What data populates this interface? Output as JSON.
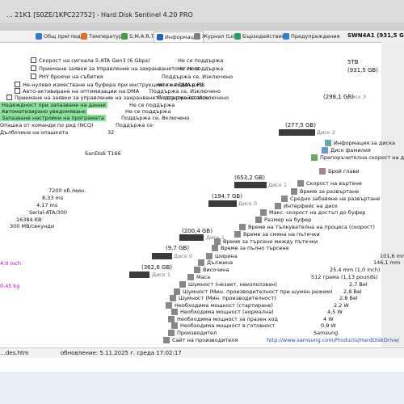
{
  "window": {
    "title": "... 21K1 [S0ZE/1KPC22752] - Hard Disk Sentinel 4.20 PRO",
    "right_model": "SWN4A1 (931,5 GB)"
  },
  "tabs": [
    {
      "label": "Общ преглед",
      "color": "#2d7bd8"
    },
    {
      "label": "Температура",
      "color": "#e07020"
    },
    {
      "label": "S.M.A.R.T.",
      "color": "#40a040"
    },
    {
      "label": "Информация",
      "color": "#2060c0"
    },
    {
      "label": "Журнал (Log)",
      "color": "#808080"
    },
    {
      "label": "Бързодействие",
      "color": "#20a060"
    },
    {
      "label": "Предупреждения",
      "color": "#3080d0"
    }
  ],
  "left_rows": [
    {
      "label": "Скорост на сигнала 5-ATA Gen3 (6 Gbps)",
      "value": "Не се поддържа"
    },
    {
      "label": "Приемане заявки за Управление на захранването от Host",
      "value": "Не се поддържа"
    },
    {
      "label": "PHY броячи на събития",
      "value": "Поддържа се, Изключено"
    },
    {
      "label": "Не-нулево изместване на буфера при инструкциите на DMA в PIS",
      "value": "Не се поддържа"
    },
    {
      "label": "Авто-активиране на оптимизации на DMA",
      "value": "Поддържа се, Изключено"
    },
    {
      "label": "Приемане на заявки за управление на захранването от устройството",
      "value": "Поддържа се, Изключено"
    },
    {
      "label": "Надеждност при запазване на данни",
      "value": "Не се поддържа"
    },
    {
      "label": "Автоматизирано уведомяване",
      "value": "Не се поддържа"
    },
    {
      "label": "Запазване настройки на програмата",
      "value": "Поддържа се, Включено"
    },
    {
      "label": "Опашка от команди по ред (NCQ)",
      "value": "Поддържа се"
    },
    {
      "label": "Дълбочина на опашката",
      "value": "32"
    }
  ],
  "left_info": [
    {
      "label": "Модел",
      "value": "SanDisk T166"
    },
    {
      "label": "Скорост",
      "value": "7200 об./мин."
    },
    {
      "label": "Време",
      "value": "8,33 ms"
    },
    {
      "label": "Латентност",
      "value": "4,17 ms"
    },
    {
      "label": "Интерфейс",
      "value": "Serial-ATA/300"
    },
    {
      "label": "Буфер",
      "value": "16384 KB"
    },
    {
      "label": "Скорост на диска",
      "value": "300 MB/секунди"
    },
    {
      "label": "Размер",
      "value": "4,0 inch"
    },
    {
      "label": "Тегло",
      "value": "0,45 kg"
    }
  ],
  "right_rows": [
    {
      "label": "Информация за диска"
    },
    {
      "label": "Диск фамилия"
    },
    {
      "label": "Препоръчителна скорост на диска"
    },
    {
      "label": "Брой глави"
    },
    {
      "label": "Скорост на въртене"
    },
    {
      "label": "Време за развъртане"
    },
    {
      "label": "Средно забавяне на развъртане"
    },
    {
      "label": "Интерфейс на диск"
    },
    {
      "label": "Макс. скорост на достъп до буфер"
    },
    {
      "label": "Размер на буфер"
    },
    {
      "label": "Време на тълкувателна на процеса (скорост)"
    },
    {
      "label": "Време за смяна на пътечки"
    },
    {
      "label": "Време за търсене между пътечки"
    },
    {
      "label": "Време за пълно търсене"
    },
    {
      "label": "Ширина",
      "value": "101,6 mm"
    },
    {
      "label": "Дължина",
      "value": "146,1 mm"
    },
    {
      "label": "Височина",
      "value": "25,4 mm (1,0 inch)"
    },
    {
      "label": "Маса",
      "value": "512 грама (1,13 pounds)"
    },
    {
      "label": "Шумност (незает, неизползван)",
      "value": "2,7 Bel"
    },
    {
      "label": "Шумност (Мин. производителност при шумен режим)",
      "value": "2,8 Bel"
    },
    {
      "label": "Шумност (Мин. производителност)",
      "value": "2,8 Bel"
    },
    {
      "label": "Необходима мощност (стартиране)",
      "value": "2,2 W"
    },
    {
      "label": "Необходима мощност (нормална)",
      "value": "4,5 W"
    },
    {
      "label": "Необходима мощност за празен ход",
      "value": "4 W"
    },
    {
      "label": "Необходима мощност в готовност",
      "value": "0,9 W"
    },
    {
      "label": "Производител",
      "value": "Samsung"
    },
    {
      "label": "Сайт на производителя",
      "value": "http://www.samsung.com/Products/HardDiskDrive/"
    }
  ],
  "disks": [
    {
      "label": "Диск 2",
      "size": "(277,5 GB)"
    },
    {
      "label": "Диск 1",
      "size": "(653,2 GB)"
    },
    {
      "label": "Диск 0",
      "size": "(194,7 GB)"
    },
    {
      "label": "Диск 1",
      "size": "(200,4 GB)"
    },
    {
      "label": "Диск 0",
      "size": "(9,7 GB)"
    },
    {
      "label": "Диск 1",
      "size": "(362,6 GB)"
    }
  ],
  "right_top": [
    {
      "text": "5TB"
    },
    {
      "text": "(931,5 GB)"
    },
    {
      "text": "(298,1 GB)"
    },
    {
      "text": "Диск 3"
    }
  ],
  "status": {
    "left": "…des.htm",
    "updated": "обновление: 5.11.2025 г. среда 17:02:17"
  }
}
